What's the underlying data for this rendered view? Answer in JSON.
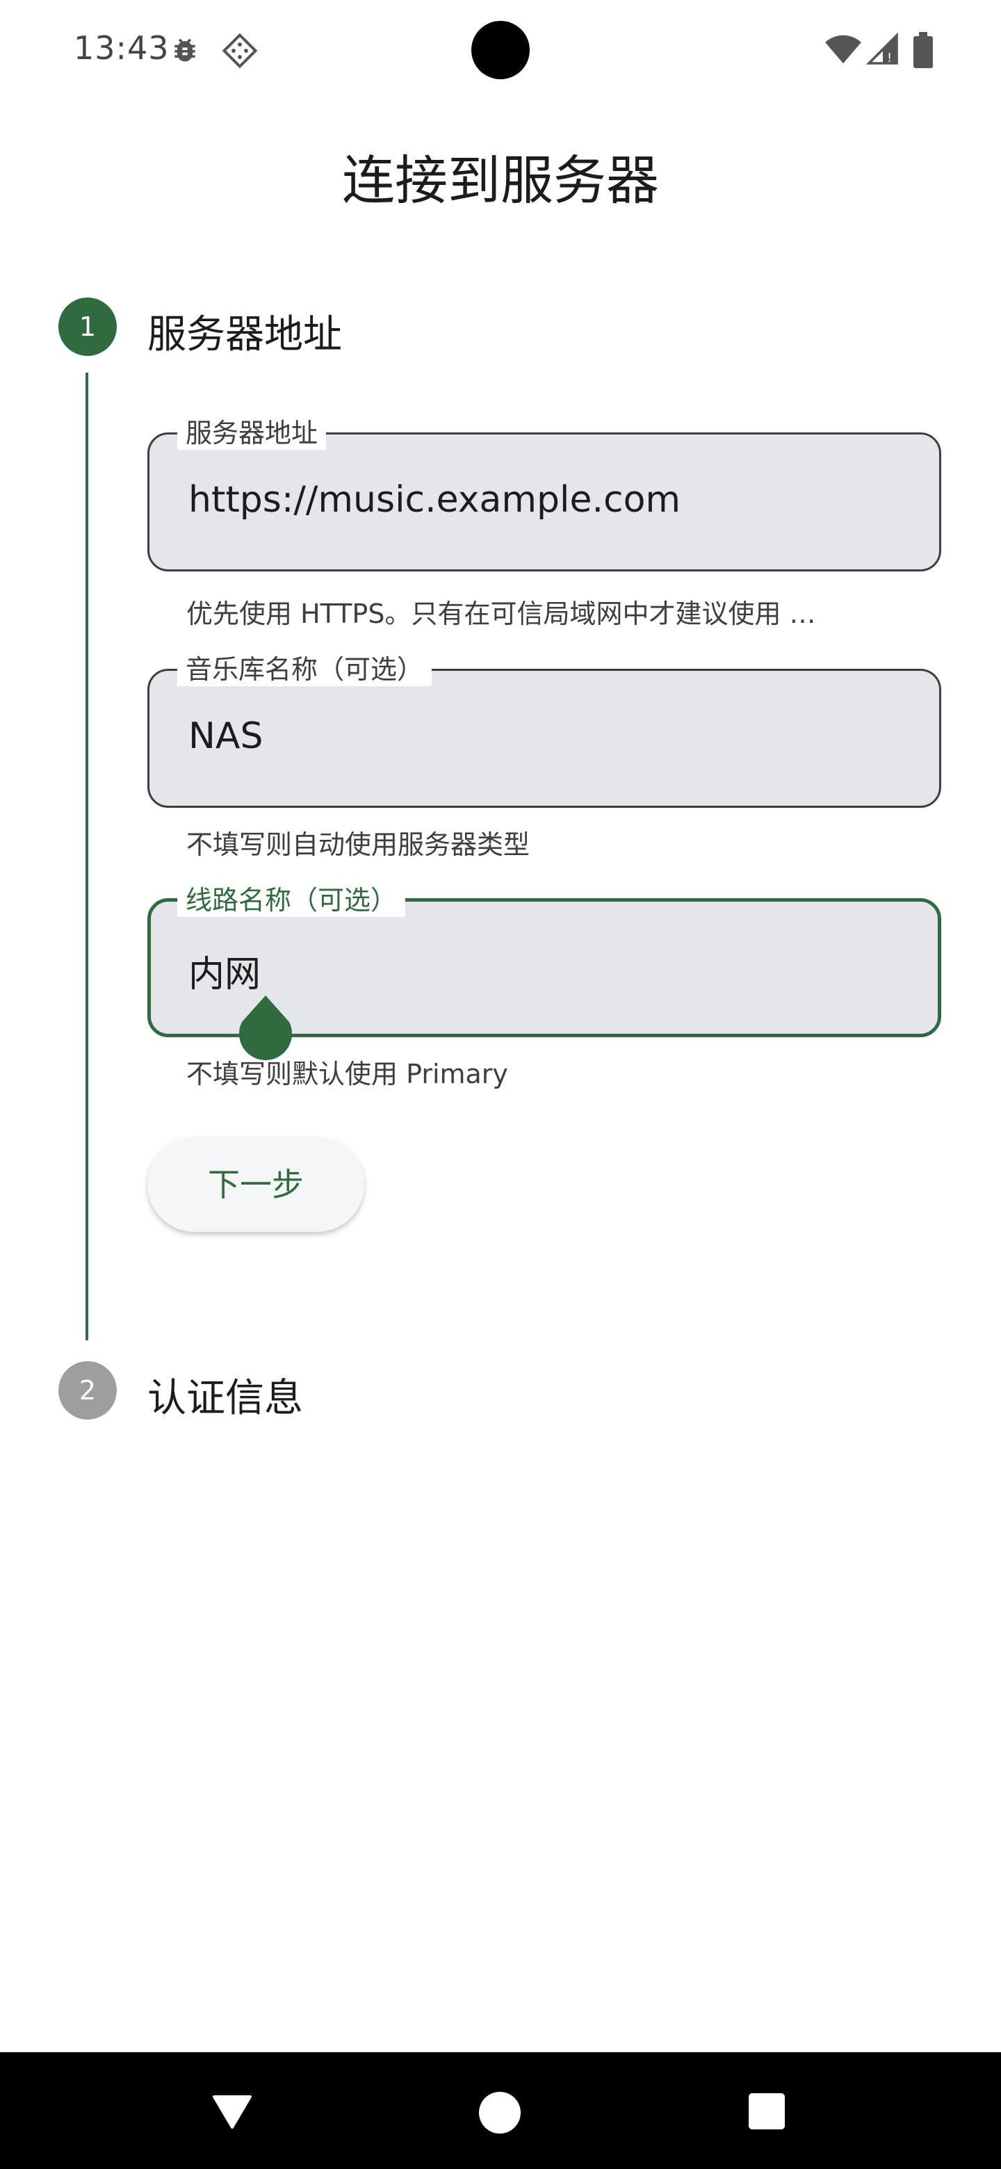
{
  "status_bar": {
    "time": "13:43",
    "left_icons": [
      "bug-icon",
      "pad-icon"
    ],
    "right_icons": [
      "wifi-icon",
      "signal-icon",
      "battery-icon"
    ]
  },
  "page": {
    "title": "连接到服务器"
  },
  "stepper": {
    "steps": [
      {
        "number": "1",
        "title": "服务器地址",
        "state": "active"
      },
      {
        "number": "2",
        "title": "认证信息",
        "state": "inactive"
      }
    ]
  },
  "form": {
    "server_address": {
      "label": "服务器地址",
      "value": "https://music.example.com",
      "helper": "优先使用 HTTPS。只有在可信局域网中才建议使用 …"
    },
    "library_name": {
      "label": "音乐库名称（可选）",
      "value": "NAS",
      "helper": "不填写则自动使用服务器类型"
    },
    "route_name": {
      "label": "线路名称（可选）",
      "value": "内网",
      "helper": "不填写则默认使用 Primary"
    },
    "next_label": "下一步"
  },
  "colors": {
    "accent": "#2f6b3f",
    "field_fill": "#e5e6e9",
    "inactive_step": "#9e9e9e"
  },
  "nav_bar": {
    "buttons": [
      "back-icon",
      "home-icon",
      "recents-icon"
    ]
  }
}
